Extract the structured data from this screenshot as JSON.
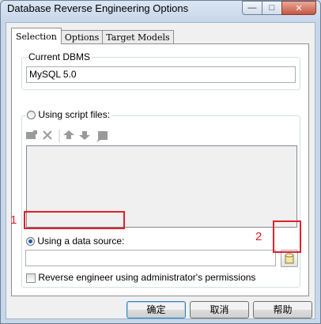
{
  "window": {
    "title": "Database Reverse Engineering Options"
  },
  "tabs": [
    {
      "label": "Selection",
      "active": true
    },
    {
      "label": "Options",
      "active": false
    },
    {
      "label": "Target Models",
      "active": false
    }
  ],
  "current_dbms": {
    "label": "Current DBMS",
    "value": "MySQL 5.0"
  },
  "script_files": {
    "radio_label": "Using script files:",
    "selected": false,
    "toolbar_icons": [
      "add-file-icon",
      "delete-icon",
      "move-up-icon",
      "move-down-icon",
      "properties-icon"
    ]
  },
  "data_source": {
    "radio_label": "Using a data source:",
    "selected": true,
    "value": ""
  },
  "admin_permissions": {
    "label": "Reverse engineer using administrator's permissions",
    "checked": false
  },
  "annotations": {
    "marker_1": "1",
    "marker_2": "2"
  },
  "buttons": {
    "ok": "确定",
    "cancel": "取消",
    "help": "帮助"
  },
  "colors": {
    "annotation_red": "#e0202a",
    "selected_radio": "#1e5fa8"
  }
}
